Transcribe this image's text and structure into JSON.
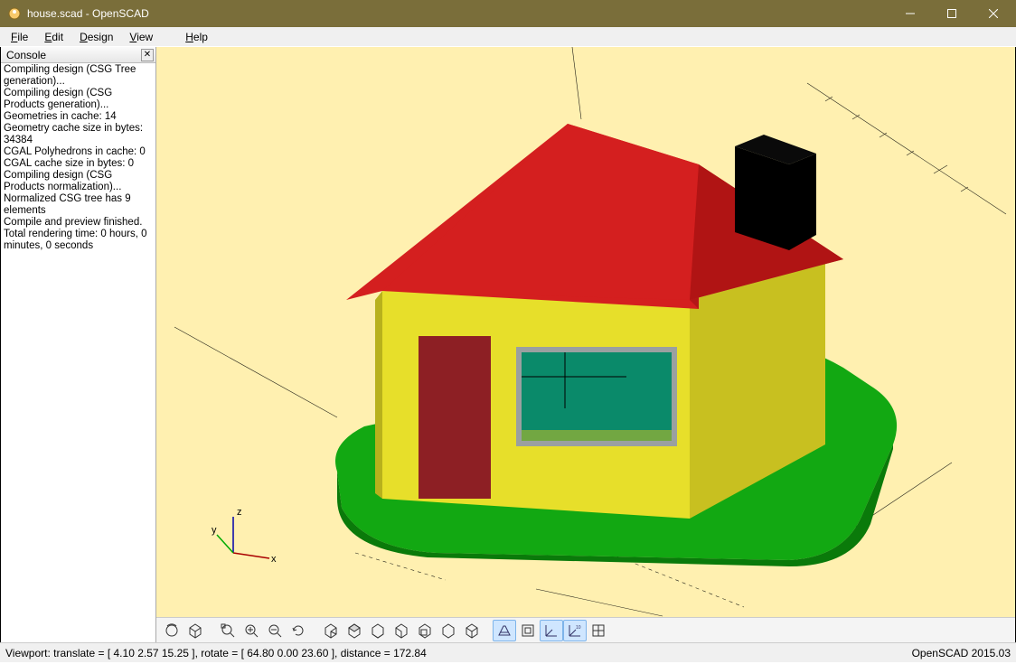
{
  "window": {
    "title": "house.scad - OpenSCAD"
  },
  "menu": {
    "file": "File",
    "edit": "Edit",
    "design": "Design",
    "view": "View",
    "help": "Help"
  },
  "console": {
    "title": "Console",
    "lines": [
      "Compiling design (CSG Tree generation)...",
      "Compiling design (CSG Products generation)...",
      "Geometries in cache: 14",
      "Geometry cache size in bytes: 34384",
      "CGAL Polyhedrons in cache: 0",
      "CGAL cache size in bytes: 0",
      "Compiling design (CSG Products normalization)...",
      "Normalized CSG tree has 9 elements",
      "Compile and preview finished.",
      "Total rendering time: 0 hours, 0 minutes, 0 seconds"
    ]
  },
  "axes": {
    "z": "z",
    "y": "y",
    "x": "x"
  },
  "toolbar_icons": [
    "preview-icon",
    "render-icon",
    "zoom-all-icon",
    "zoom-in-icon",
    "zoom-out-icon",
    "reset-view-icon",
    "view-right-icon",
    "view-top-icon",
    "view-bottom-icon",
    "view-left-icon",
    "view-front-icon",
    "view-back-icon",
    "view-diagonal-icon",
    "perspective-icon",
    "orthogonal-icon",
    "axes-icon",
    "axes-scale-icon",
    "crosshair-icon"
  ],
  "status": {
    "left": "Viewport: translate = [ 4.10 2.57 15.25 ], rotate = [ 64.80 0.00 23.60 ], distance = 172.84",
    "right": "OpenSCAD 2015.03"
  }
}
